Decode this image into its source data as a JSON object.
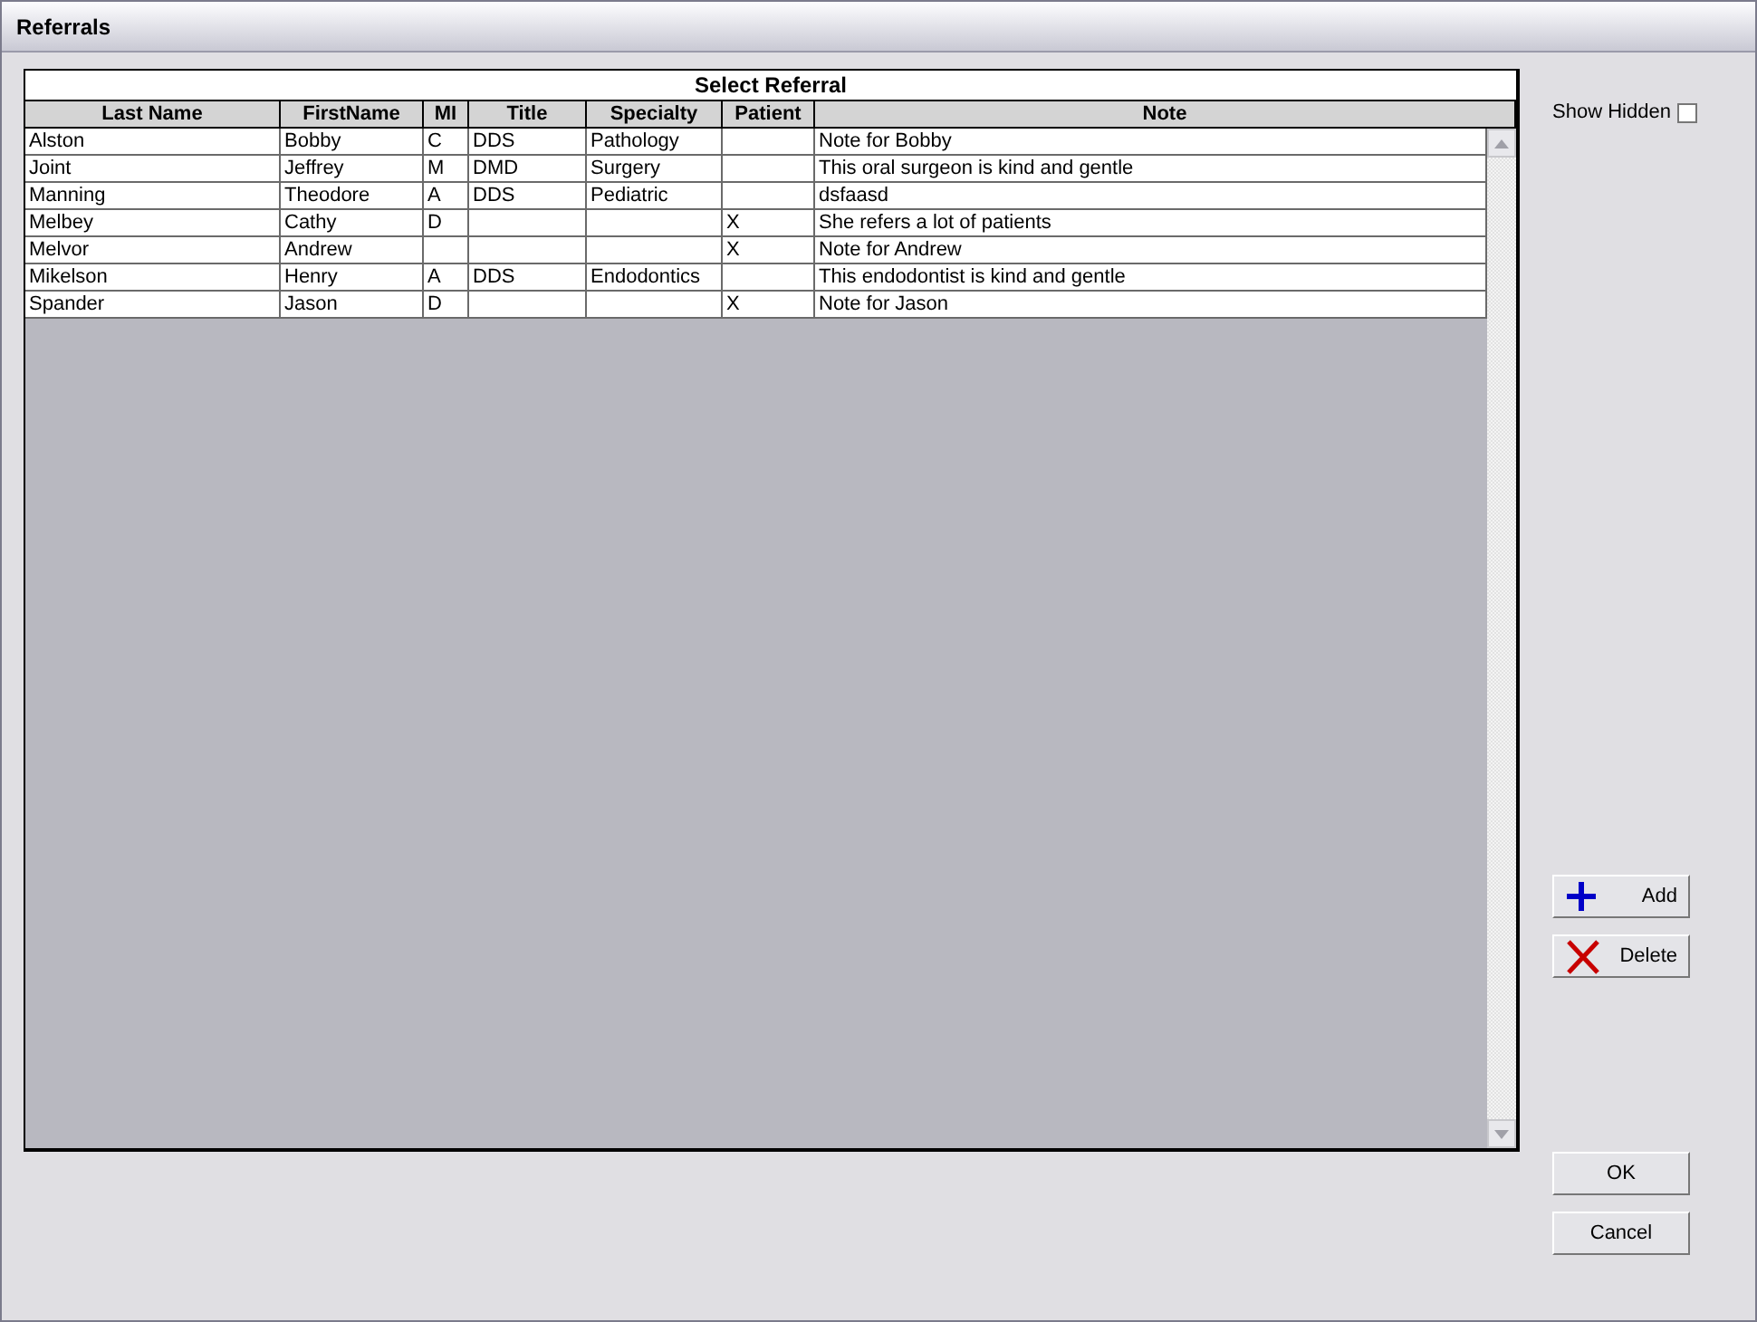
{
  "window": {
    "title": "Referrals"
  },
  "grid": {
    "title": "Select Referral",
    "columns": [
      "Last Name",
      "FirstName",
      "MI",
      "Title",
      "Specialty",
      "Patient",
      "Note"
    ],
    "rows": [
      [
        "Alston",
        "Bobby",
        "C",
        "DDS",
        "Pathology",
        "",
        "Note for Bobby"
      ],
      [
        "Joint",
        "Jeffrey",
        "M",
        "DMD",
        "Surgery",
        "",
        "This oral surgeon is kind and gentle"
      ],
      [
        "Manning",
        "Theodore",
        "A",
        "DDS",
        "Pediatric",
        "",
        "dsfaasd"
      ],
      [
        "Melbey",
        "Cathy",
        "D",
        "",
        "",
        "X",
        "She refers a lot of patients"
      ],
      [
        "Melvor",
        "Andrew",
        "",
        "",
        "",
        "X",
        "Note for Andrew"
      ],
      [
        "Mikelson",
        "Henry",
        "A",
        "DDS",
        "Endodontics",
        "",
        "This endodontist is kind and gentle"
      ],
      [
        "Spander",
        "Jason",
        "D",
        "",
        "",
        "X",
        "Note for Jason"
      ]
    ]
  },
  "show_hidden": {
    "label": "Show Hidden",
    "checked": false
  },
  "buttons": [
    {
      "label": "Add",
      "kind": "add"
    },
    {
      "label": "Delete",
      "kind": "delete"
    }
  ],
  "dialog_buttons": [
    "OK",
    "Cancel"
  ]
}
